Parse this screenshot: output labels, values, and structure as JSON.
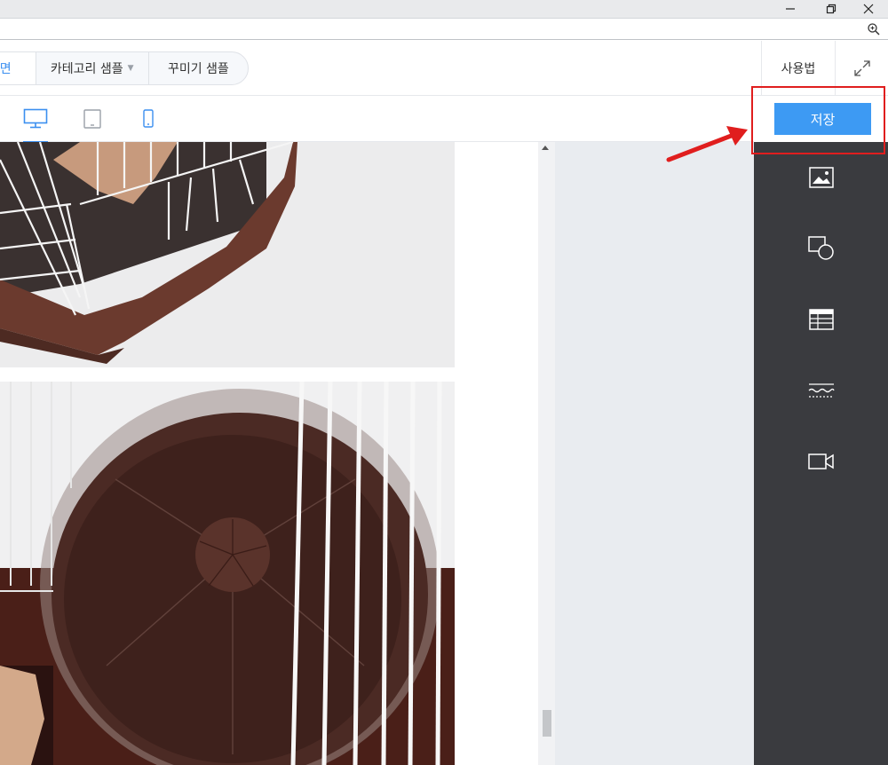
{
  "topbar": {
    "tabs": [
      {
        "label": "면"
      },
      {
        "label": "카테고리 샘플"
      },
      {
        "label": "꾸미기 샘플"
      }
    ],
    "help_label": "사용법"
  },
  "toolbar": {
    "save_label": "저장"
  },
  "devices": [
    "desktop-icon",
    "tablet-icon",
    "mobile-icon"
  ],
  "tools": [
    "image-icon",
    "shape-icon",
    "table-icon",
    "divider-icon",
    "video-icon"
  ],
  "colors": {
    "accent": "#3d9af3",
    "tools_panel": "#3a3b3f",
    "highlight": "#e01e1e"
  }
}
